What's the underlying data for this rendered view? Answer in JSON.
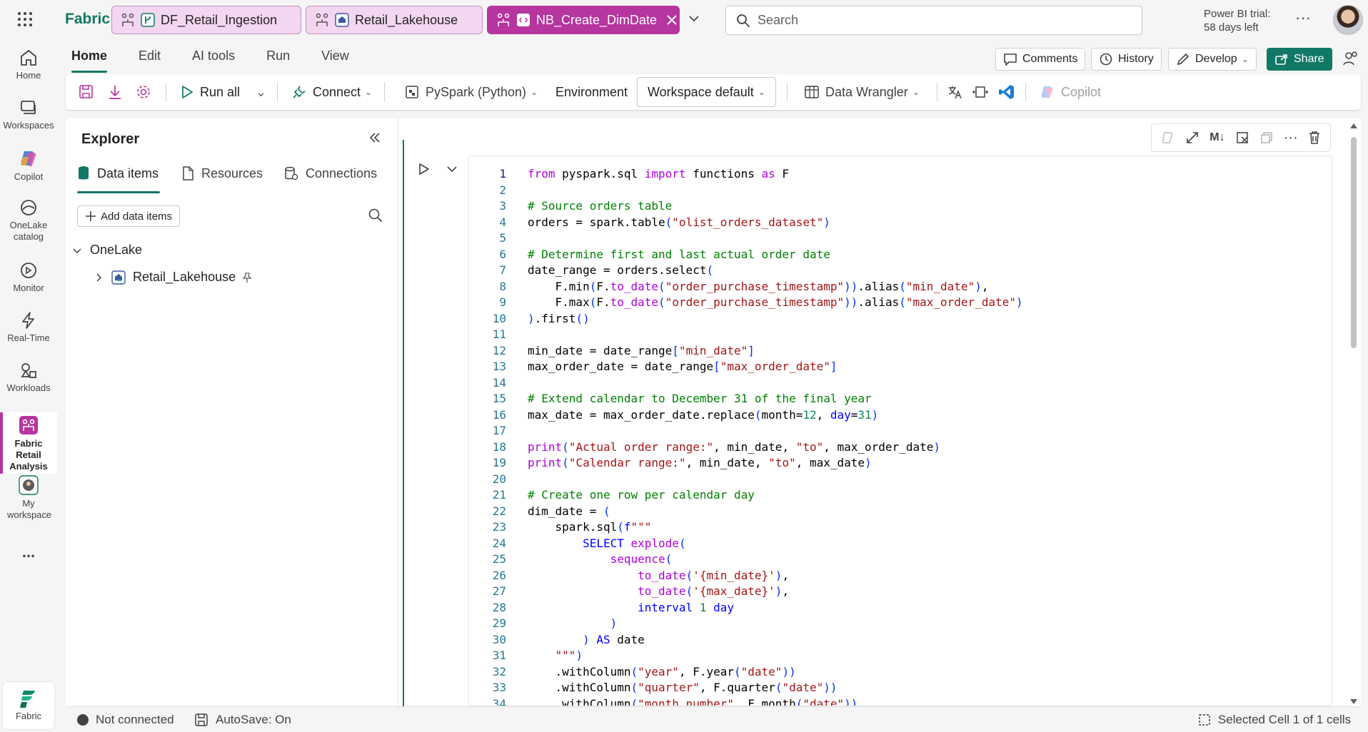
{
  "app": {
    "brand": "Fabric"
  },
  "tabs": [
    {
      "label": "DF_Retail_Ingestion"
    },
    {
      "label": "Retail_Lakehouse"
    },
    {
      "label": "NB_Create_DimDate"
    }
  ],
  "search": {
    "placeholder": "Search"
  },
  "trial": {
    "line1": "Power BI trial:",
    "line2": "58 days left"
  },
  "rail": [
    {
      "label": "Home",
      "icon": "home-icon"
    },
    {
      "label": "Workspaces",
      "icon": "workspaces-icon"
    },
    {
      "label": "Copilot",
      "icon": "copilot-icon"
    },
    {
      "label": "OneLake catalog",
      "icon": "onelake-icon"
    },
    {
      "label": "Monitor",
      "icon": "monitor-icon"
    },
    {
      "label": "Real-Time",
      "icon": "lightning-icon"
    },
    {
      "label": "Workloads",
      "icon": "workloads-icon"
    },
    {
      "label": "Fabric Retail Analysis",
      "icon": "workspace-icon"
    },
    {
      "label": "My workspace",
      "icon": "my-workspace-icon"
    },
    {
      "label": "...",
      "icon": "more-icon"
    }
  ],
  "rail_bottom": {
    "label": "Fabric"
  },
  "ribbon": {
    "tabs": [
      "Home",
      "Edit",
      "AI tools",
      "Run",
      "View"
    ],
    "comments": "Comments",
    "history": "History",
    "develop": "Develop",
    "share": "Share"
  },
  "toolbar": {
    "run_all": "Run all",
    "connect": "Connect",
    "language": "PySpark (Python)",
    "environment": "Environment",
    "workspace_default": "Workspace default",
    "data_wrangler": "Data Wrangler",
    "copilot": "Copilot"
  },
  "explorer": {
    "title": "Explorer",
    "tabs": [
      "Data items",
      "Resources",
      "Connections"
    ],
    "add_items": "Add data items",
    "tree_root": "OneLake",
    "tree_item": "Retail_Lakehouse"
  },
  "cell_tools": {
    "markdown": "M↓"
  },
  "status": {
    "connection": "Not connected",
    "autosave": "AutoSave: On",
    "selection": "Selected Cell 1 of 1 cells"
  },
  "colors": {
    "accent": "#117865",
    "tab_active": "#b6359f",
    "tab_pink": "#f3d7f1"
  },
  "code_lines": [
    "from pyspark.sql import functions as F",
    "",
    "# Source orders table",
    "orders = spark.table(\"olist_orders_dataset\")",
    "",
    "# Determine first and last actual order date",
    "date_range = orders.select(",
    "    F.min(F.to_date(\"order_purchase_timestamp\")).alias(\"min_date\"),",
    "    F.max(F.to_date(\"order_purchase_timestamp\")).alias(\"max_order_date\")",
    ").first()",
    "",
    "min_date = date_range[\"min_date\"]",
    "max_order_date = date_range[\"max_order_date\"]",
    "",
    "# Extend calendar to December 31 of the final year",
    "max_date = max_order_date.replace(month=12, day=31)",
    "",
    "print(\"Actual order range:\", min_date, \"to\", max_order_date)",
    "print(\"Calendar range:\", min_date, \"to\", max_date)",
    "",
    "# Create one row per calendar day",
    "dim_date = (",
    "    spark.sql(f\"\"\"",
    "        SELECT explode(",
    "            sequence(",
    "                to_date('{min_date}'),",
    "                to_date('{max_date}'),",
    "                interval 1 day",
    "            )",
    "        ) AS date",
    "    \"\"\")",
    "    .withColumn(\"year\", F.year(\"date\"))",
    "    .withColumn(\"quarter\", F.quarter(\"date\"))",
    "    .withColumn(\"month_number\", F.month(\"date\"))"
  ]
}
